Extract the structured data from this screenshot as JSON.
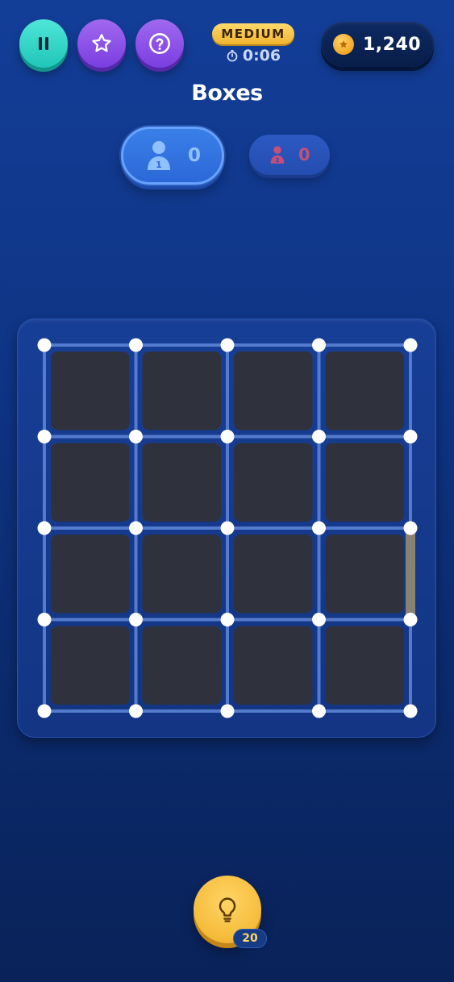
{
  "header": {
    "difficulty": "MEDIUM",
    "timer": "0:06",
    "coins": "1,240"
  },
  "title": "Boxes",
  "players": {
    "p1": {
      "number": "1",
      "score": "0"
    },
    "p2": {
      "number": "2",
      "score": "0"
    }
  },
  "board": {
    "rows": 4,
    "cols": 4,
    "highlight_edge": {
      "orientation": "vertical",
      "col": 4,
      "row": 2,
      "color": "#8a8270"
    }
  },
  "hint": {
    "count": "20"
  },
  "colors": {
    "pause_button": "#2fd3c5",
    "purple_button": "#8a4ee8",
    "difficulty_badge": "#f6c54a",
    "cell": "#2f323c",
    "line": "#5f87d8",
    "dot": "#ffffff",
    "player1": "#3a7fe8",
    "player2": "#2c59c2",
    "hint_button": "#f6bd3d"
  },
  "icons": {
    "pause": "pause-icon",
    "star": "star-icon",
    "help": "question-icon",
    "timer": "stopwatch-icon",
    "coin": "coin-icon",
    "player": "person-icon",
    "hint": "lightbulb-icon"
  }
}
